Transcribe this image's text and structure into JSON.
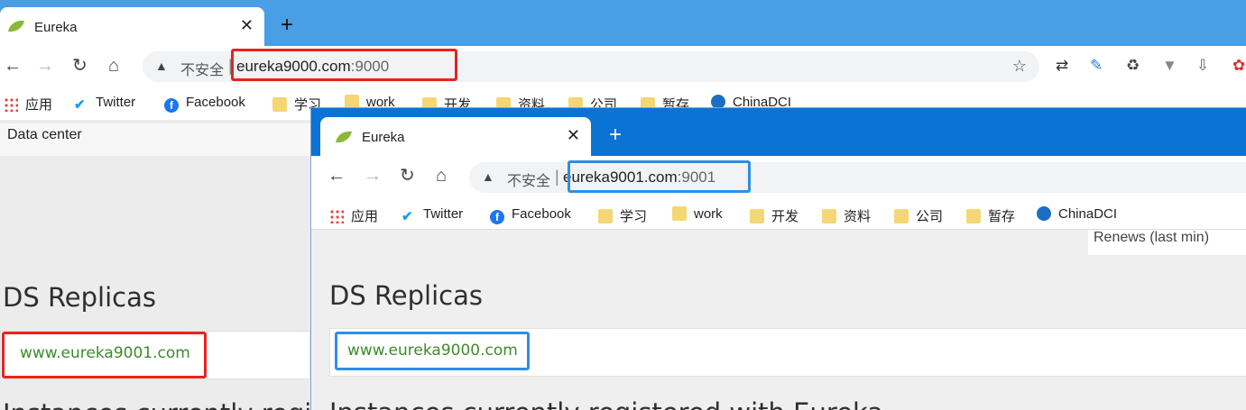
{
  "back_window": {
    "tab_title": "Eureka",
    "new_tab": "+",
    "security_label": "不安全",
    "url_host": "eureka9000.com",
    "url_port": ":9000",
    "bookmarks": [
      "应用",
      "Twitter",
      "Facebook",
      "学习",
      "work",
      "开发",
      "资料",
      "公司",
      "暂存",
      "ChinaDCI"
    ],
    "data_center": "Data center",
    "ds_replicas_title": "DS Replicas",
    "replica_link": "www.eureka9001.com",
    "instances_title": "Instances currently registered with Eureka"
  },
  "front_window": {
    "tab_title": "Eureka",
    "new_tab": "+",
    "security_label": "不安全",
    "url_host": "eureka9001.com",
    "url_port": ":9001",
    "bookmarks": [
      "应用",
      "Twitter",
      "Facebook",
      "学习",
      "work",
      "开发",
      "资料",
      "公司",
      "暂存",
      "ChinaDCI"
    ],
    "renews_label": "Renews (last min)",
    "ds_replicas_title": "DS Replicas",
    "replica_link": "www.eureka9000.com",
    "instances_title": "Instances currently registered with Eureka"
  },
  "colors": {
    "back_tabstrip": "#4a9ee6",
    "front_tabstrip": "#0a73d4",
    "highlight_red": "#e8231c",
    "highlight_blue": "#2d8ee6",
    "replica_link": "#3e8b2b"
  }
}
